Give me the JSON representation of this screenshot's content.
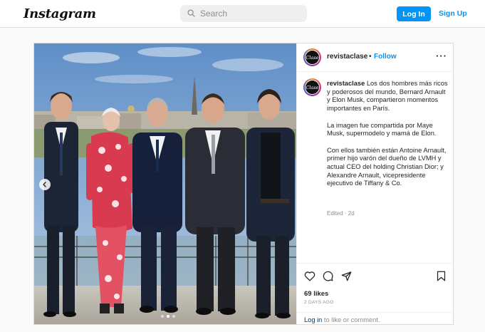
{
  "topbar": {
    "logo": "Instagram",
    "search_placeholder": "Search",
    "login_label": "Log In",
    "signup_label": "Sign Up"
  },
  "post": {
    "username": "revistaclase",
    "follow_label": "Follow",
    "separator": "•",
    "avatar_text": "Clase",
    "caption_paragraphs": [
      "Los dos hombres más ricos y poderosos del mundo, Bernard Arnault y Elon Musk, compartieron momentos importantes en París.",
      "La imagen fue compartida por Maye Musk, supermodelo y mamá de Elon.",
      "Con ellos también están Antoine Arnault, primer hijo varón del dueño de LVMH y actual CEO del holding Christian Dior; y Alexandre Arnault, vicepresidente ejecutivo de Tiffany & Co."
    ],
    "edited": "Edited · 2d",
    "likes": "69 likes",
    "time_ago": "2 DAYS AGO",
    "login_link": "Log in",
    "login_rest": " to like or comment.",
    "carousel": {
      "slide_count": 3,
      "active_slide": 1
    }
  },
  "colors": {
    "accent": "#0095f6",
    "text": "#262626",
    "muted": "#8e8e8e",
    "border": "#dbdbdb"
  }
}
